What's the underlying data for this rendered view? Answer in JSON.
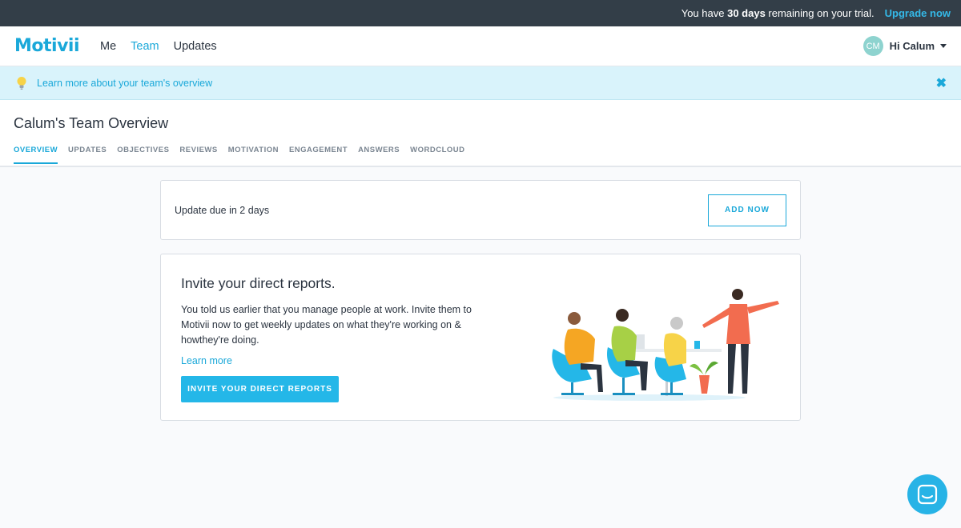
{
  "trial": {
    "prefix": "You have ",
    "days": "30 days",
    "suffix": " remaining on your trial.",
    "upgrade_label": "Upgrade now"
  },
  "nav": {
    "logo": "Motivii",
    "items": [
      {
        "label": "Me",
        "active": false
      },
      {
        "label": "Team",
        "active": true
      },
      {
        "label": "Updates",
        "active": false
      }
    ],
    "user": {
      "initials": "CM",
      "greeting": "Hi Calum"
    }
  },
  "banner": {
    "text": "Learn more about your team's overview",
    "icon": "lightbulb-icon",
    "close_icon": "close-icon"
  },
  "page": {
    "title": "Calum's Team Overview",
    "tabs": [
      {
        "label": "OVERVIEW",
        "active": true
      },
      {
        "label": "UPDATES",
        "active": false
      },
      {
        "label": "OBJECTIVES",
        "active": false
      },
      {
        "label": "REVIEWS",
        "active": false
      },
      {
        "label": "MOTIVATION",
        "active": false
      },
      {
        "label": "ENGAGEMENT",
        "active": false
      },
      {
        "label": "ANSWERS",
        "active": false
      },
      {
        "label": "WORDCLOUD",
        "active": false
      }
    ]
  },
  "update_card": {
    "text": "Update due in 2 days",
    "button_label": "ADD NOW"
  },
  "invite_card": {
    "title": "Invite your direct reports.",
    "body": "You told us earlier that you manage people at work. Invite them to Motivii now to get weekly updates on what they're working on & howthey're doing.",
    "learn_more": "Learn more",
    "button_label": "INVITE YOUR DIRECT REPORTS"
  },
  "colors": {
    "accent": "#1aa8d9",
    "trial_bar": "#333e48",
    "banner_bg": "#d9f3fb"
  }
}
